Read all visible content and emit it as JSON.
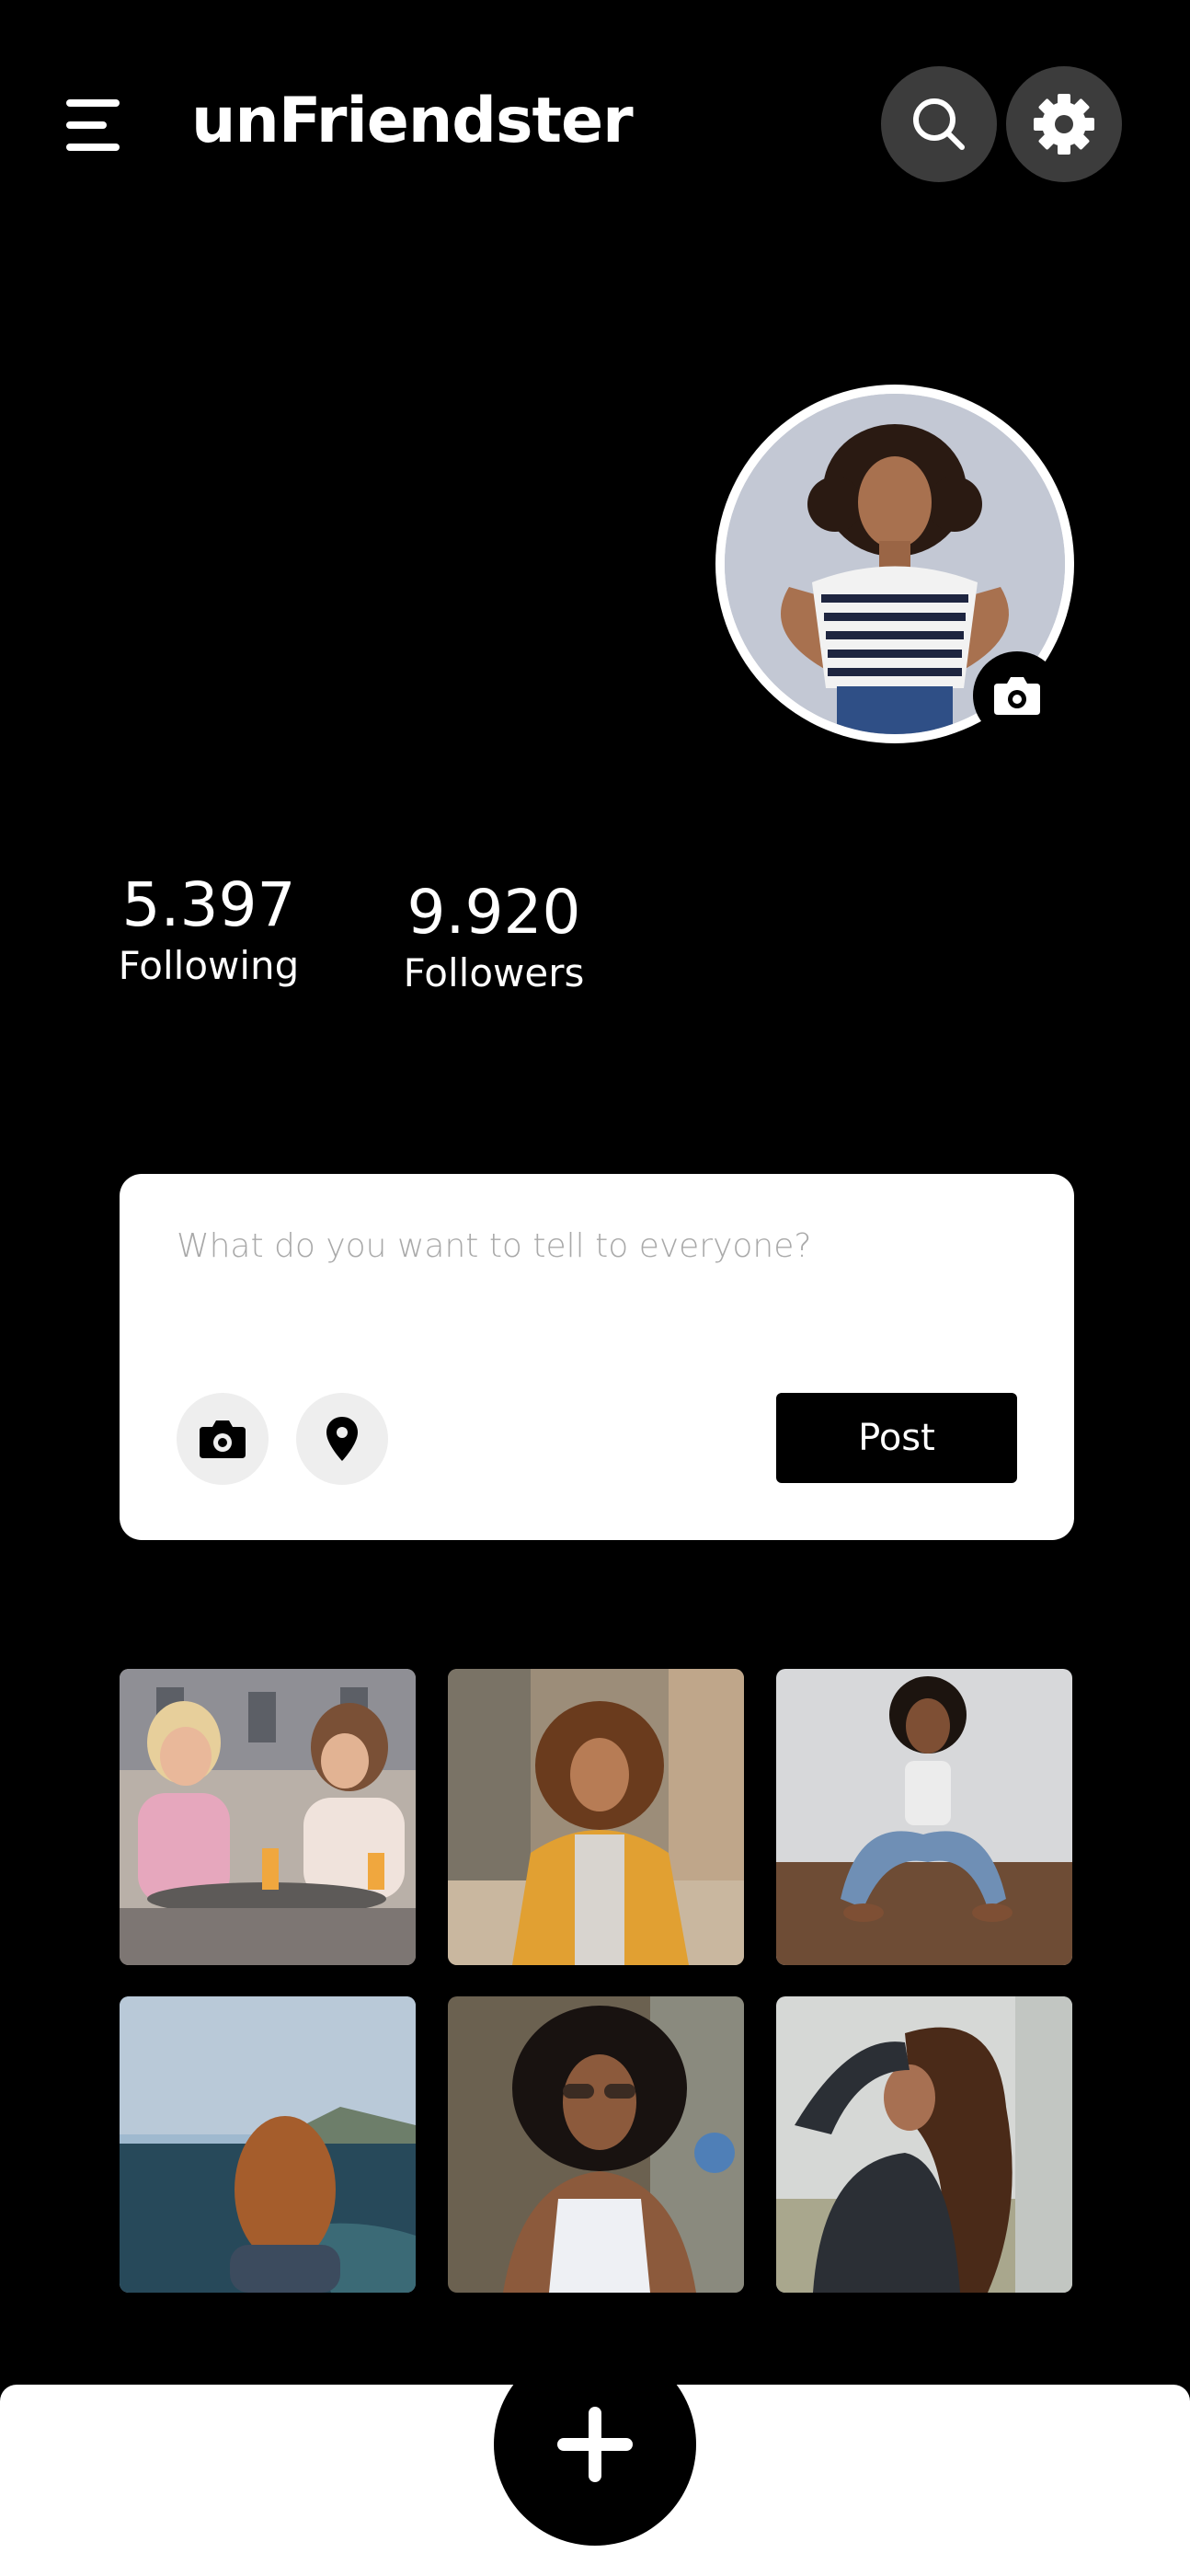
{
  "header": {
    "title": "unFriendster",
    "menu_icon": "hamburger-menu-icon",
    "search_icon": "search-icon",
    "settings_icon": "gear-icon"
  },
  "profile": {
    "avatar_alt": "profile-photo",
    "camera_icon": "camera-icon"
  },
  "stats": {
    "following_value": "5.397",
    "following_label": "Following",
    "followers_value": "9.920",
    "followers_label": "Followers"
  },
  "composer": {
    "placeholder": "What do you want to tell to everyone?",
    "value": "",
    "camera_icon": "camera-icon",
    "location_icon": "location-pin-icon",
    "post_label": "Post"
  },
  "photos": [
    {
      "name": "photo-friends-cafe"
    },
    {
      "name": "photo-yellow-coat"
    },
    {
      "name": "photo-sitting-floor"
    },
    {
      "name": "photo-ocean-view"
    },
    {
      "name": "photo-sunglasses"
    },
    {
      "name": "photo-leather-jacket"
    }
  ],
  "bottom_bar": {
    "add_icon": "plus-icon"
  },
  "colors": {
    "background": "#000000",
    "surface": "#ffffff",
    "header_button": "#3c3c3c",
    "icon_button": "#eeeeee"
  }
}
